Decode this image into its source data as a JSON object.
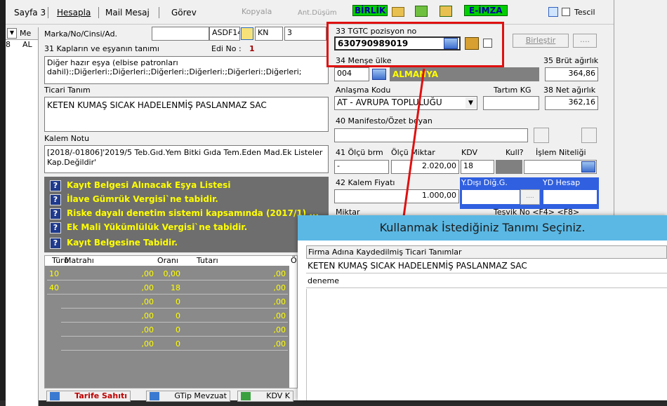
{
  "toolbar": {
    "sayfa": "Sayfa 3",
    "hesapla": "Hesapla",
    "mail_mesaj": "Mail Mesaj",
    "gorev": "Görev",
    "kopyala": "Kopyala",
    "ant_dusum": "Ant.Düşüm",
    "birlik": "BİRLİK",
    "e_imza": "E-İMZA",
    "tescil": "Tescil"
  },
  "left_grid": {
    "col_header": "Me",
    "cell_a": "AL",
    "cell_b": "8"
  },
  "form": {
    "marka_label": "Marka/No/Cinsi/Ad.",
    "marka_value": "",
    "marka_code": "ASDF14",
    "kn_label": "KN",
    "kn_value": "3",
    "kaplar_label": "31 Kapların ve eşyanın tanımı",
    "edi_label": "Edi No :",
    "edi_value": "1",
    "kaplar_text": "Diğer hazır eşya (elbise patronları dahil):;Diğerleri:;Diğerleri:;Diğerleri:;Diğerleri:;Diğerleri:;Diğerleri;",
    "ticari_label": "Ticari Tanım",
    "ticari_value": "KETEN KUMAŞ SICAK HADELENMİŞ PASLANMAZ SAC",
    "kalem_notu_label": "Kalem Notu",
    "kalem_notu_value": "[2018/-01806]'2019/5 Teb.Gıd.Yem Bitki Gıda Tem.Eden Mad.Ek Listeler Kap.Değildir'"
  },
  "right_form": {
    "tgtc_label": "33 TGTC pozisyon no",
    "tgtc_value": "630790989019",
    "birlestir": "Birleştir",
    "dots": "....",
    "mense_label": "34 Menşe ülke",
    "mense_code": "004",
    "mense_name": "ALMANYA",
    "brut_label": "35 Brüt ağırlık",
    "brut_value": "364,86",
    "anlasma_label": "Anlaşma Kodu",
    "anlasma_value": "AT   - AVRUPA TOPLULUĞU",
    "tartim_label": "Tartım KG",
    "net_label": "38 Net ağırlık",
    "net_value": "362,16",
    "manifesto_label": "40 Manifesto/Özet beyan",
    "olcu_label": "41 Ölçü brm",
    "olcu_miktar_label": "Ölçü Miktar",
    "kdv_label": "KDV",
    "kull_label": "Kull?",
    "islem_label": "İşlem Niteliği",
    "olcu_value": "-",
    "miktar_value": "2.020,00",
    "kdv_value": "18",
    "fiyat_label": "42 Kalem Fiyatı",
    "fiyat_value": "1.000,00",
    "ydisi_label": "Y.Dışı Diğ.G.",
    "yd_hesap_label": "YD Hesap",
    "miktar_label": "Miktar",
    "tesvik_label": "Teşvik No <F4>  <F8>"
  },
  "warnings": [
    "Kayıt Belgesi Alınacak Eşya Listesi",
    "İlave Gümrük Vergisi`ne tabidir.",
    "Riske dayalı denetim sistemi kapsamında (2017/1) ...",
    "Ek Mali Yükümlülük Vergisi`ne tabidir.",
    "Kayıt Belgesine Tabidir."
  ],
  "tax_table": {
    "headers": [
      "Türü",
      "Matrahı",
      "Oranı",
      "Tutarı",
      "Ö"
    ],
    "rows": [
      [
        "10",
        ",00",
        "0,00",
        ",00"
      ],
      [
        "40",
        ",00",
        "18",
        ",00"
      ],
      [
        "",
        ",00",
        "0",
        ",00"
      ],
      [
        "",
        ",00",
        "0",
        ",00"
      ],
      [
        "",
        ",00",
        "0",
        ",00"
      ],
      [
        "",
        ",00",
        "0",
        ",00"
      ]
    ]
  },
  "bottom_buttons": {
    "tarife": "Tarife Sahıtı",
    "gtip": "GTip Mevzuat",
    "kdv": "KDV K"
  },
  "dialog": {
    "title": "Kullanmak İstediğiniz Tanımı Seçiniz.",
    "column_header": "Firma Adına Kaydedilmiş Ticari Tanımlar",
    "items": [
      "KETEN KUMAŞ SICAK HADELENMİŞ PASLANMAZ SAC",
      "deneme"
    ]
  },
  "colors": {
    "accent_red": "#e01010",
    "dialog_title": "#5bb8e4",
    "warn_yellow": "#ffff00",
    "birlik_green": "#00d000"
  }
}
